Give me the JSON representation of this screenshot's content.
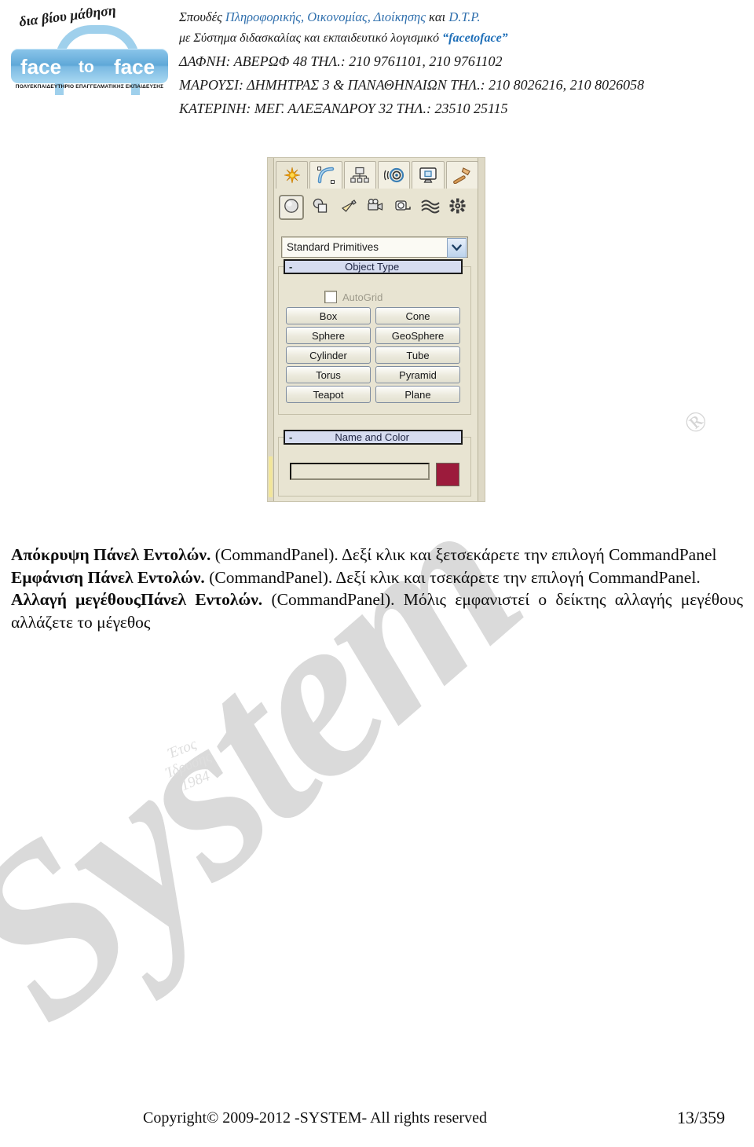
{
  "header": {
    "logo": {
      "script_text": "δια βίου μάθηση",
      "word1": "face",
      "word2": "to",
      "word3": "face",
      "subtitle": "ΠΟΛΥΕΚΠΑΙΔΕΥΤΗΡΙΟ ΕΠΑΓΓΕΛΜΑΤΙΚΗΣ ΕΚΠΑΙΔΕΥΣΗΣ"
    },
    "line1": {
      "prefix": "Σπουδές ",
      "highlight": "Πληροφορικής, Οικονομίας, Διοίκησης",
      "middle": " και ",
      "highlight2": "D.T.P."
    },
    "line2": {
      "text": "με Σύστημα διδασκαλίας και εκπαιδευτικό λογισμικό ",
      "brand": "“facetoface”"
    },
    "line3": "ΔΑΦΝΗ: ΑΒΕΡΩΦ 48 ΤΗΛ.: 210 9761101, 210 9761102",
    "line4": "ΜΑΡΟΥΣΙ: ΔΗΜΗΤΡΑΣ 3 & ΠΑΝΑΘΗΝΑΙΩΝ ΤΗΛ.: 210 8026216, 210 8026058",
    "line5": "ΚΑΤΕΡΙΝΗ: ΜΕΓ. ΑΛΕΞΑΝΔΡΟΥ 32 ΤΗΛ.: 23510 25115"
  },
  "command_panel": {
    "tabs": [
      {
        "name": "create-tab",
        "icon": "star-icon",
        "active": true
      },
      {
        "name": "modify-tab",
        "icon": "curve-arc-icon",
        "active": false
      },
      {
        "name": "hierarchy-tab",
        "icon": "hierarchy-tree-icon",
        "active": false
      },
      {
        "name": "motion-tab",
        "icon": "motion-wheel-icon",
        "active": false
      },
      {
        "name": "display-tab",
        "icon": "monitor-icon",
        "active": false
      },
      {
        "name": "utilities-tab",
        "icon": "hammer-icon",
        "active": false
      }
    ],
    "categories": [
      {
        "name": "geometry-category",
        "icon": "sphere-icon",
        "selected": true
      },
      {
        "name": "shapes-category",
        "icon": "shapes-overlap-icon",
        "selected": false
      },
      {
        "name": "lights-category",
        "icon": "spotlight-icon",
        "selected": false
      },
      {
        "name": "cameras-category",
        "icon": "camera-icon",
        "selected": false
      },
      {
        "name": "helpers-category",
        "icon": "tape-measure-icon",
        "selected": false
      },
      {
        "name": "space-warps-category",
        "icon": "waves-icon",
        "selected": false
      },
      {
        "name": "systems-category",
        "icon": "gear-burst-icon",
        "selected": false
      }
    ],
    "dropdown": {
      "value": "Standard Primitives",
      "arrow": "chevron-down-icon"
    },
    "object_type": {
      "collapse": "-",
      "title": "Object Type",
      "autogrid_label": "AutoGrid",
      "autogrid_checked": false,
      "buttons": [
        "Box",
        "Cone",
        "Sphere",
        "GeoSphere",
        "Cylinder",
        "Tube",
        "Torus",
        "Pyramid",
        "Teapot",
        "Plane"
      ]
    },
    "name_and_color": {
      "collapse": "-",
      "title": "Name and Color",
      "name_value": "",
      "color_swatch": "#9c1b3c"
    }
  },
  "body": {
    "paragraph1": {
      "bold": "Απόκρυψη Πάνελ Εντολών.",
      "rest": " (CommandPanel). Δεξί κλικ και ξετσεκάρετε την επιλογή CommandPanel"
    },
    "paragraph2": {
      "bold": "Εμφάνιση Πάνελ Εντολών.",
      "rest": " (CommandPanel). Δεξί κλικ και τσεκάρετε την επιλογή CommandPanel."
    },
    "paragraph3": {
      "bold": "Αλλαγή μεγέθουςΠάνελ Εντολών.",
      "rest": " (CommandPanel). Μόλις εμφανιστεί ο δείκτης αλλαγής μεγέθους αλλάζετε το μέγεθος"
    }
  },
  "watermark": {
    "word": "System",
    "registered": "®",
    "script_line1": "Έτος",
    "script_line2": "Ίδρυσης",
    "script_line3": "1984"
  },
  "footer": {
    "copyright": "Copyright© 2009-2012 -SYSTEM- All rights reserved",
    "page": "13/359"
  },
  "colors": {
    "accent_blue": "#2f6fad",
    "brand_blue": "#1f6fb8",
    "panel_bg": "#e8e4d2",
    "rollout_head": "#d6dcf0",
    "swatch": "#9c1b3c",
    "watermark_grey": "#d9d9d9"
  }
}
